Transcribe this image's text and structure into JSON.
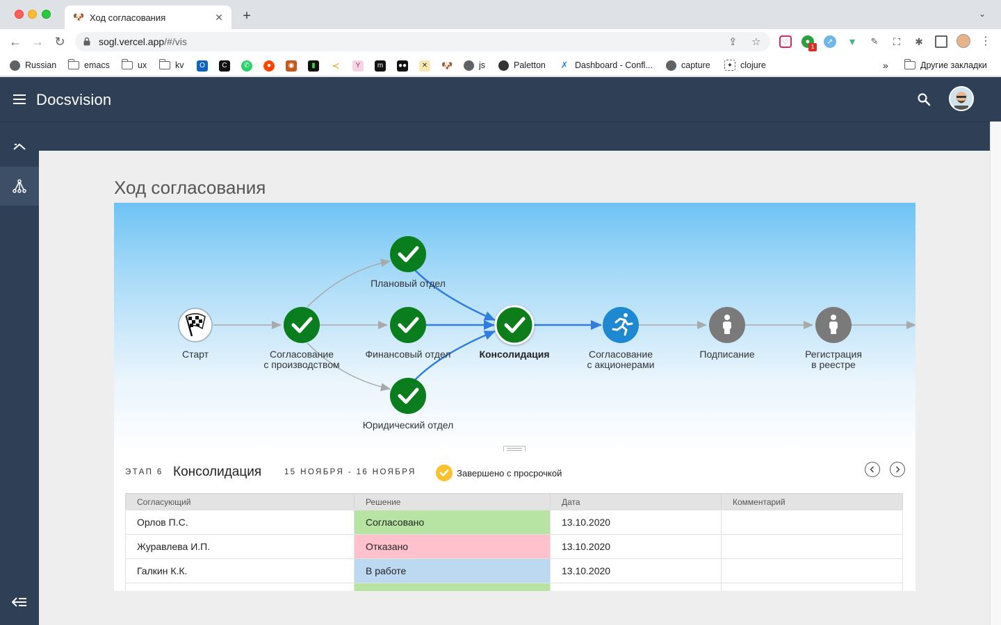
{
  "browser": {
    "tab_title": "Ход согласования",
    "url_host": "sogl.vercel.app",
    "url_path": "/#/vis",
    "bookmarks": [
      {
        "label": "Russian",
        "icon": "globe-icon"
      },
      {
        "label": "emacs",
        "icon": "folder-icon"
      },
      {
        "label": "ux",
        "icon": "folder-icon"
      },
      {
        "label": "kv",
        "icon": "folder-icon"
      },
      {
        "label": "js",
        "icon": "globe-icon"
      },
      {
        "label": "Paletton",
        "icon": "paletton-icon"
      },
      {
        "label": "Dashboard - Confl...",
        "icon": "confluence-icon"
      },
      {
        "label": "capture",
        "icon": "globe-icon"
      },
      {
        "label": "clojure",
        "icon": "clojure-icon"
      }
    ],
    "other_bookmarks": "Другие закладки",
    "overflow": "»",
    "ext_badge": "1"
  },
  "app": {
    "brand": "Docsvision",
    "page_title": "Ход согласования"
  },
  "workflow": {
    "nodes": [
      {
        "id": "start",
        "label": "Старт",
        "state": "start"
      },
      {
        "id": "prod",
        "label": "Согласование\nс производством",
        "state": "done"
      },
      {
        "id": "plan",
        "label": "Плановый отдел",
        "state": "done"
      },
      {
        "id": "fin",
        "label": "Финансовый отдел",
        "state": "done"
      },
      {
        "id": "legal",
        "label": "Юридический отдел",
        "state": "done"
      },
      {
        "id": "cons",
        "label": "Консолидация",
        "state": "current"
      },
      {
        "id": "share",
        "label": "Согласование\nс акционерами",
        "state": "active"
      },
      {
        "id": "sign",
        "label": "Подписание",
        "state": "pending"
      },
      {
        "id": "reg",
        "label": "Регистрация\nв реестре",
        "state": "pending"
      }
    ],
    "colors": {
      "done": "#0a7d1f",
      "active": "#1e88d0",
      "pending": "#7a7a7a",
      "edge_active": "#2f7de1",
      "edge": "#a9a9a9"
    }
  },
  "stage": {
    "kicker": "ЭТАП 6",
    "title": "Консолидация",
    "dates": "15 НОЯБРЯ - 16 НОЯБРЯ",
    "status": "Завершено с просрочкой",
    "status_color": "#f9c22e"
  },
  "table": {
    "headers": [
      "Согласующий",
      "Решение",
      "Дата",
      "Комментарий"
    ],
    "rows": [
      {
        "person": "Орлов П.С.",
        "decision": "Согласовано",
        "decision_kind": "ok",
        "date": "13.10.2020",
        "comment": ""
      },
      {
        "person": "Журавлева И.П.",
        "decision": "Отказано",
        "decision_kind": "no",
        "date": "13.10.2020",
        "comment": ""
      },
      {
        "person": "Галкин К.К.",
        "decision": "В работе",
        "decision_kind": "work",
        "date": "13.10.2020",
        "comment": ""
      }
    ]
  }
}
